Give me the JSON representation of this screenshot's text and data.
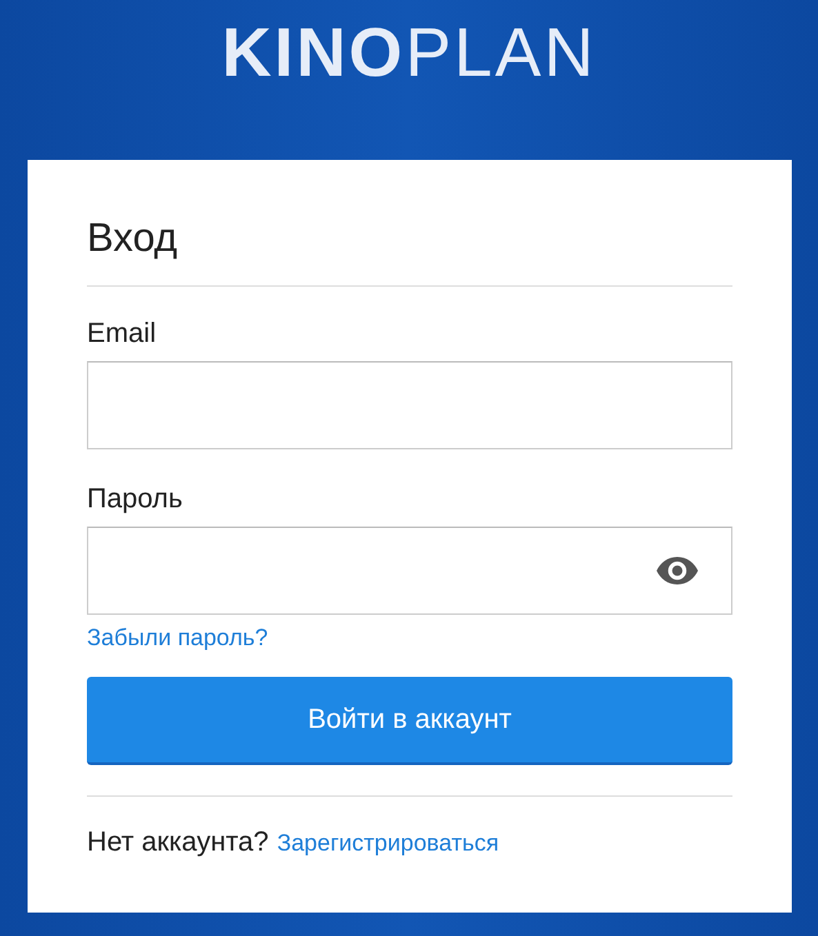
{
  "logo": "**KINO**PLAN",
  "form": {
    "title": "Вход",
    "fields": [
      {
        "label": "Email",
        "kind": "text"
      },
      {
        "label": "Пароль",
        "kind": "password"
      }
    ],
    "forgot_link": "Забыли пароль?",
    "submit_button": "Войти в аккаунт",
    "footer_text": "Нет аккаунта?",
    "register_link": "Зарегистрироваться"
  }
}
